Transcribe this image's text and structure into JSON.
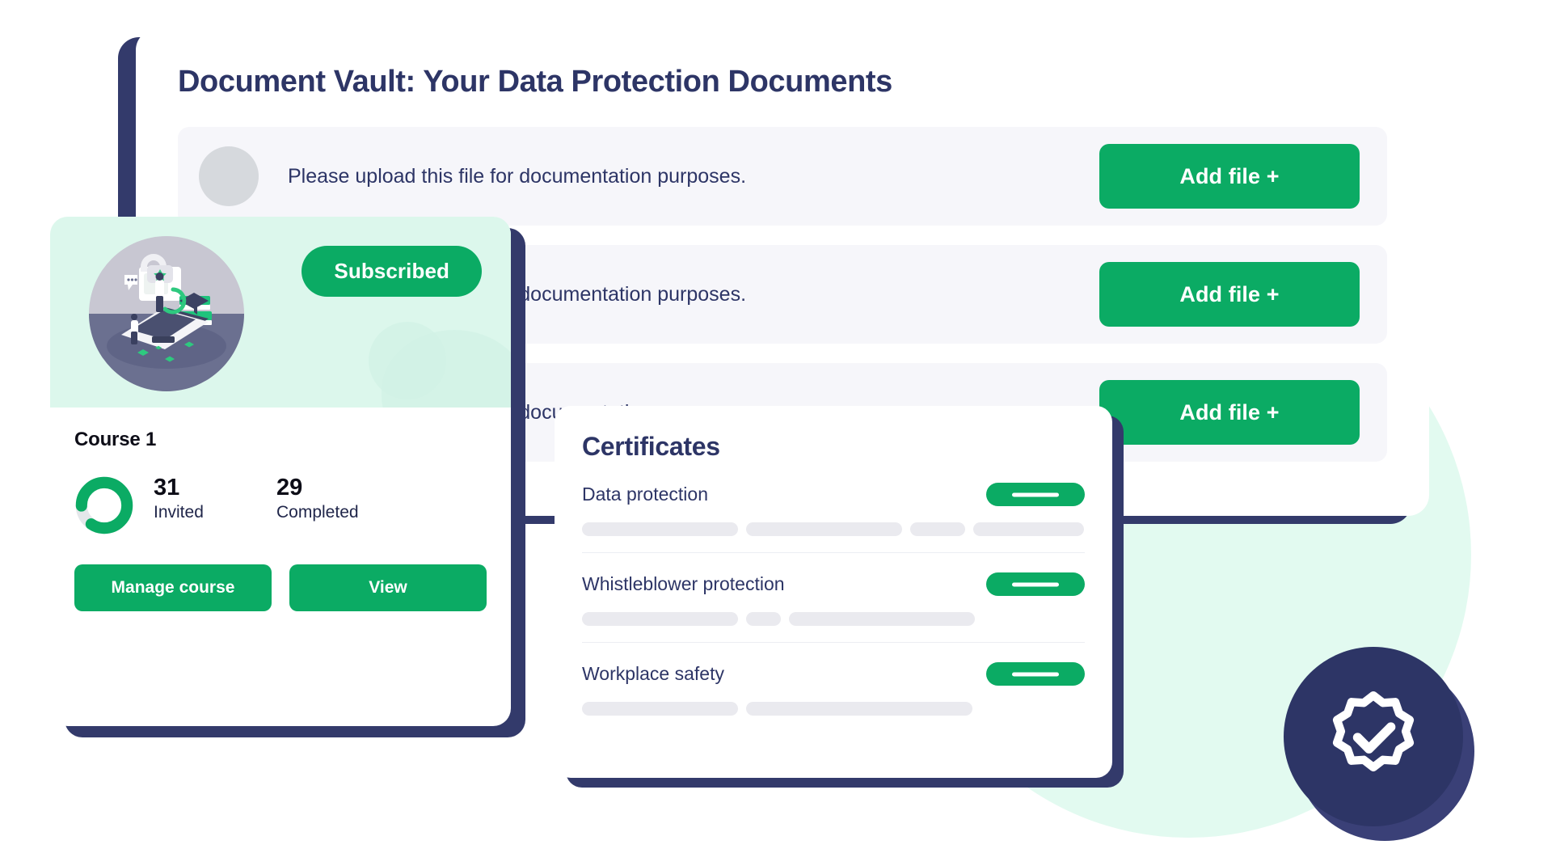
{
  "vault": {
    "title": "Document Vault: Your Data Protection Documents",
    "rows": [
      {
        "label": "Please upload this file for documentation purposes.",
        "button": "Add file +",
        "avatar": "avatar-placeholder"
      },
      {
        "label": "Please upload this file for documentation purposes.",
        "button": "Add file +",
        "avatar": "avatar-placeholder"
      },
      {
        "label": "Please upload this file for documentation purposes.",
        "button": "Add file +",
        "avatar": "avatar-placeholder"
      }
    ]
  },
  "course": {
    "status_badge": "Subscribed",
    "name": "Course 1",
    "stats": [
      {
        "value": "31",
        "label": "Invited"
      },
      {
        "value": "29",
        "label": "Completed"
      }
    ],
    "donut": {
      "percent": 85,
      "track_color": "#e4e7ea",
      "fill_color": "#0bab64"
    },
    "actions": [
      {
        "label": "Manage course"
      },
      {
        "label": "View"
      }
    ]
  },
  "certificates": {
    "title": "Certificates",
    "items": [
      {
        "name": "Data protection",
        "pill": "certificate-pill",
        "skeleton": [
          31,
          31,
          11,
          22
        ]
      },
      {
        "name": "Whistleblower protection",
        "pill": "certificate-pill",
        "skeleton": [
          31,
          7,
          37
        ]
      },
      {
        "name": "Workplace safety",
        "pill": "certificate-pill",
        "skeleton": [
          31,
          45
        ]
      }
    ]
  },
  "verified": {
    "icon": "verified-badge-icon"
  },
  "colors": {
    "brand_green": "#0bab64",
    "navy": "#2d3566",
    "mint": "#e2faf0",
    "hero_mint": "#dcf7ec",
    "row_bg": "#f6f6fa",
    "skeleton": "#eaeaef"
  }
}
